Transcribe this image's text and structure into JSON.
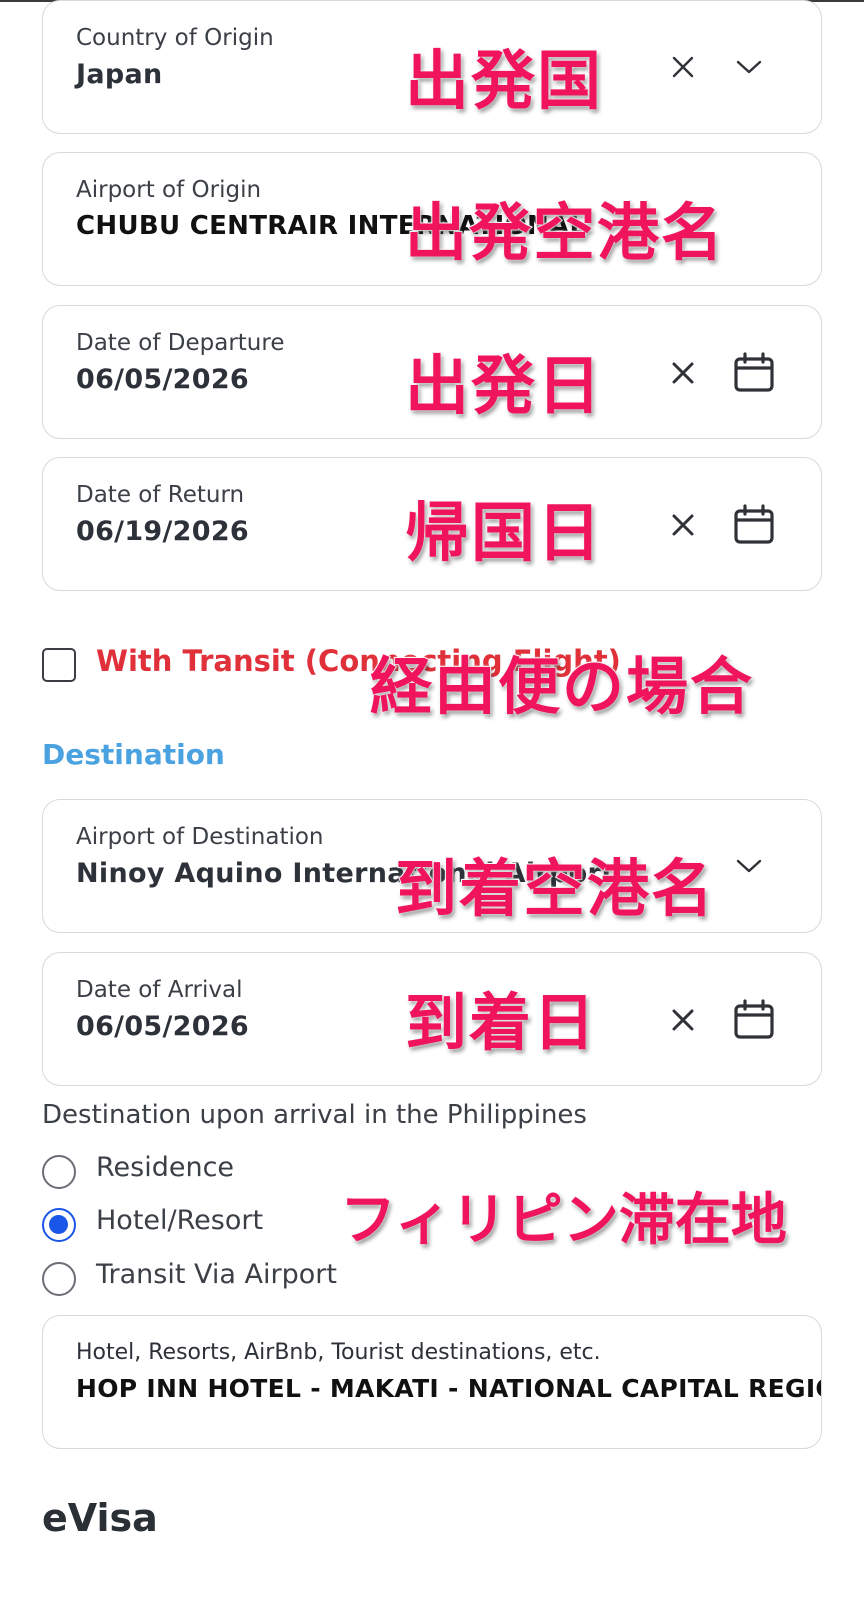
{
  "origin": {
    "country_label": "Country of Origin",
    "country_value": "Japan",
    "airport_label": "Airport of Origin",
    "airport_value": "CHUBU CENTRAIR INTERNATIONAL",
    "departure_label": "Date of Departure",
    "departure_value": "06/05/2026",
    "return_label": "Date of Return",
    "return_value": "06/19/2026"
  },
  "transit": {
    "label": "With Transit (Connecting Flight)",
    "checked": false
  },
  "destination": {
    "section_title": "Destination",
    "airport_label": "Airport of Destination",
    "airport_value": "Ninoy Aquino International Airport",
    "arrival_label": "Date of Arrival",
    "arrival_value": "06/05/2026",
    "upon_arrival_question": "Destination upon arrival in the Philippines",
    "options": [
      "Residence",
      "Hotel/Resort",
      "Transit Via Airport"
    ],
    "selected_option": "Hotel/Resort",
    "hotel_label": "Hotel, Resorts, AirBnb, Tourist destinations, etc.",
    "hotel_value": "HOP INN HOTEL - MAKATI - NATIONAL CAPITAL REGION"
  },
  "overlays": {
    "country": "出発国",
    "airport_origin": "出発空港名",
    "departure": "出発日",
    "return": "帰国日",
    "transit": "経由便の場合",
    "airport_destination": "到着空港名",
    "arrival": "到着日",
    "stay": "フィリピン滞在地"
  },
  "evisa": {
    "title": "eVisa"
  },
  "colors": {
    "overlay_text": "#f0145c",
    "transit_label": "#e0303a",
    "section_title": "#4aa3e0",
    "radio_selected": "#1a56e8",
    "field_border": "#d7d9de"
  },
  "icons": [
    "clear-icon",
    "chevron-down-icon",
    "calendar-icon"
  ]
}
